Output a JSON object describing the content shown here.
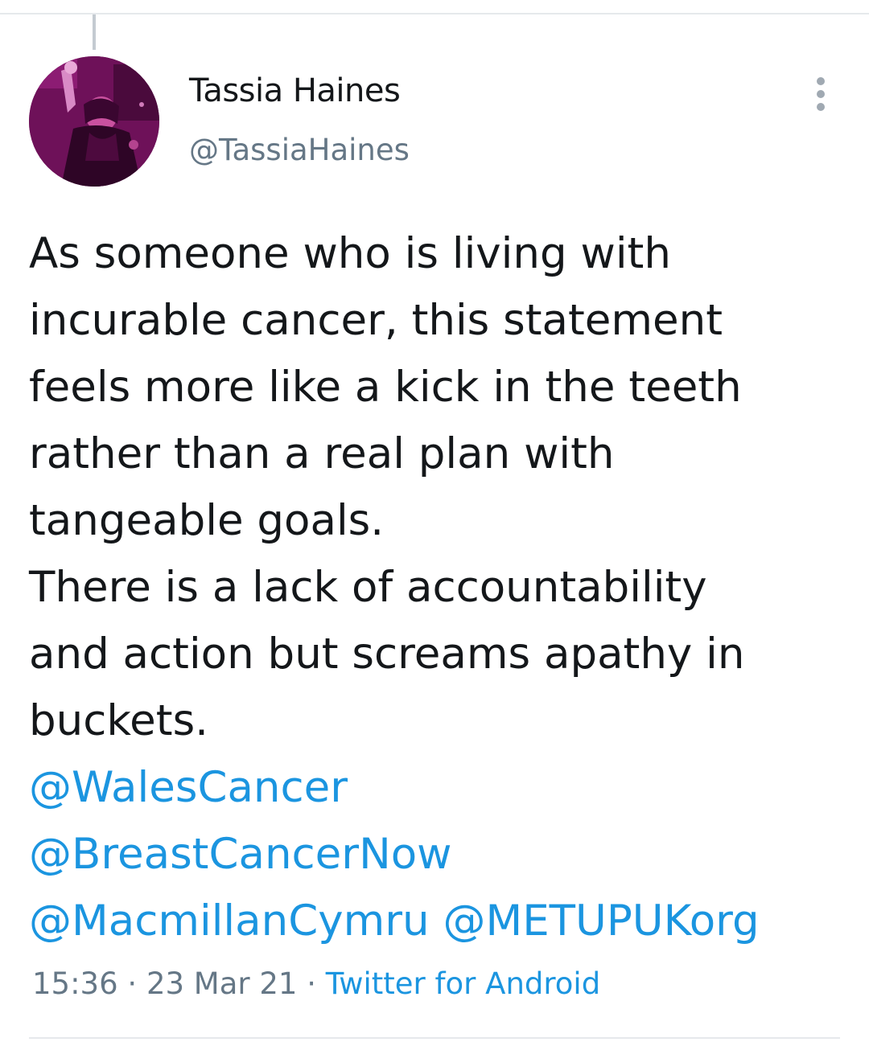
{
  "author": {
    "display_name": "Tassia Haines",
    "handle": "@TassiaHaines"
  },
  "tweet": {
    "text": "As someone who is living with\nincurable cancer, this statement\nfeels more like a kick in the teeth\nrather than a real plan with\ntangeable goals.\nThere is a lack of accountability\nand  action but screams apathy in\nbuckets.",
    "mentions": [
      "@WalesCancer",
      "@BreastCancerNow",
      "@MacmillanCymru",
      "@METUPUKorg"
    ]
  },
  "meta": {
    "time": "15:36",
    "separator": "·",
    "date": "23 Mar 21",
    "source": "Twitter for Android"
  },
  "icons": {
    "more": "vertical-ellipsis-icon",
    "avatar": "profile-photo"
  },
  "colors": {
    "link": "#1b95e0",
    "secondary_text": "#657786",
    "primary_text": "#14171a",
    "avatar_tint": "#9b1f7f"
  }
}
